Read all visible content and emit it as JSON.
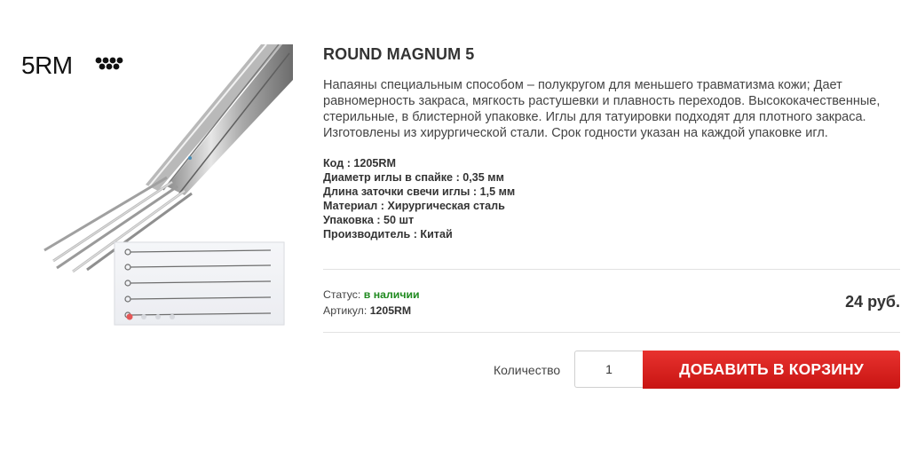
{
  "image": {
    "label": "5RM",
    "icon": "needle-dots-icon"
  },
  "product": {
    "title": "ROUND MAGNUM 5",
    "description": "Напаяны специальным способом – полукругом для меньшего травматизма кожи; Дает равномерность закраса, мягкость растушевки и плавность переходов. Высококачественные, стерильные, в блистерной упаковке. Иглы для татуировки подходят для плотного закраса. Изготовлены из хирургической стали. Срок годности указан на каждой упаковке игл.",
    "specs": [
      "Код : 1205RM",
      "Диаметр иглы в спайке : 0,35 мм",
      "Длина заточки свечи иглы : 1,5 мм",
      "Материал : Хирургическая сталь",
      "Упаковка : 50 шт",
      "Производитель : Китай"
    ]
  },
  "status": {
    "label": "Статус:",
    "value": "в наличии",
    "value_color": "#1f8a1f"
  },
  "article": {
    "label": "Артикул:",
    "value": "1205RM"
  },
  "price": "24 руб.",
  "cart": {
    "quantity_label": "Количество",
    "quantity_value": "1",
    "add_button_label": "ДОБАВИТЬ В КОРЗИНУ",
    "button_color": "#d91e1b"
  }
}
